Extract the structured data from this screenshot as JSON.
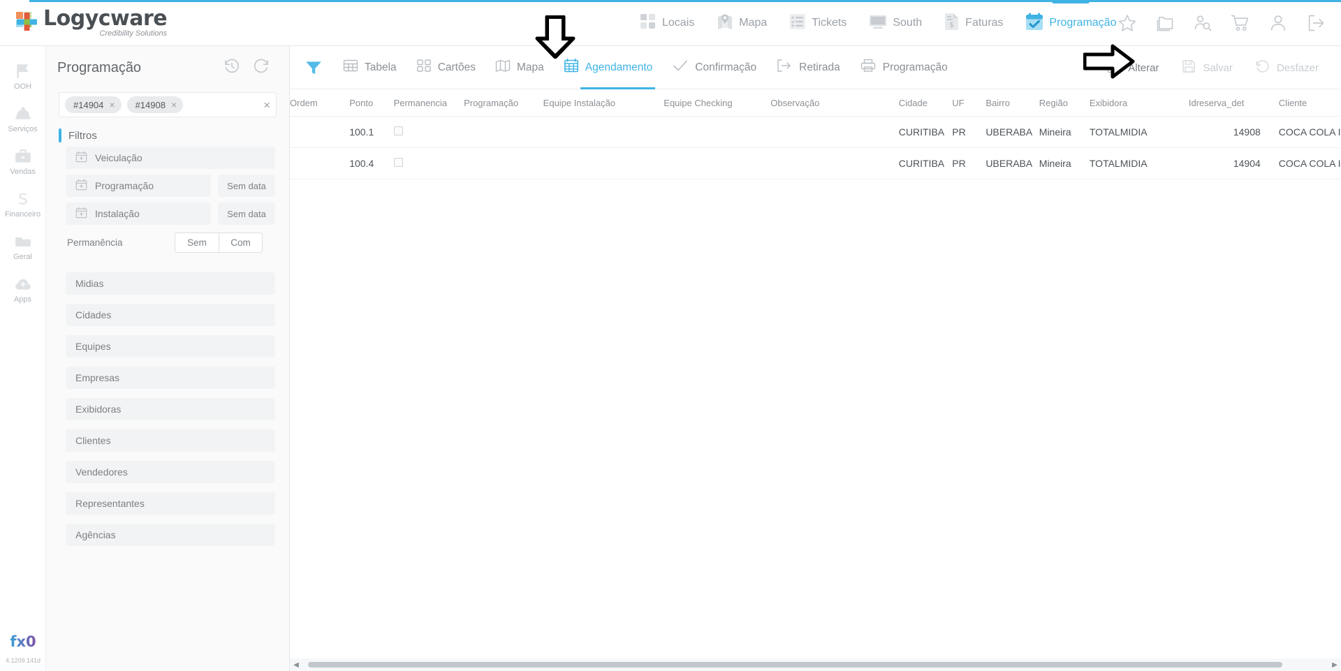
{
  "brand": {
    "name": "Logycware",
    "tagline": "Credibility Solutions",
    "version": "4.1209.141d",
    "accent_color": "#3fb3e4",
    "footer_logo": "fx0-logo"
  },
  "topnav": {
    "items": [
      {
        "label": "Locais",
        "icon": "grid-squares-icon",
        "active": false
      },
      {
        "label": "Mapa",
        "icon": "map-pin-icon",
        "active": false
      },
      {
        "label": "Tickets",
        "icon": "checklist-icon",
        "active": false
      },
      {
        "label": "South",
        "icon": "monitor-icon",
        "active": false
      },
      {
        "label": "Faturas",
        "icon": "invoice-dollar-icon",
        "active": false
      },
      {
        "label": "Programação",
        "icon": "calendar-check-icon",
        "active": true
      }
    ],
    "icons": [
      {
        "name": "favorites-star-icon"
      },
      {
        "name": "folders-icon"
      },
      {
        "name": "user-search-icon"
      },
      {
        "name": "shopping-cart-icon"
      },
      {
        "name": "user-account-icon"
      },
      {
        "name": "logout-icon"
      }
    ]
  },
  "rail": {
    "items": [
      {
        "label": "OOH",
        "icon": "flag-icon"
      },
      {
        "label": "Serviços",
        "icon": "hardhat-icon"
      },
      {
        "label": "Vendas",
        "icon": "briefcase-icon"
      },
      {
        "label": "Financeiro",
        "icon": "dollar-sign-icon"
      },
      {
        "label": "Geral",
        "icon": "folder-icon"
      },
      {
        "label": "Apps",
        "icon": "cloud-plus-icon"
      }
    ]
  },
  "panel": {
    "title": "Programação",
    "history_icon": "history-clock-icon",
    "refresh_icon": "refresh-icon",
    "chips": [
      {
        "label": "#14904"
      },
      {
        "label": "#14908"
      }
    ],
    "chips_clear": "×",
    "section_label": "Filtros",
    "filters": [
      {
        "label": "Veiculação",
        "icon": "calendar-plus-icon",
        "value": ""
      },
      {
        "label": "Programação",
        "icon": "calendar-plus-icon",
        "value": "Sem data"
      },
      {
        "label": "Instalação",
        "icon": "calendar-plus-icon",
        "value": "Sem data"
      }
    ],
    "permanencia": {
      "label": "Permanência",
      "options": [
        "Sem",
        "Com"
      ]
    },
    "accordion": [
      {
        "label": "Midias"
      },
      {
        "label": "Cidades"
      },
      {
        "label": "Equipes"
      },
      {
        "label": "Empresas"
      },
      {
        "label": "Exibidoras"
      },
      {
        "label": "Clientes"
      },
      {
        "label": "Vendedores"
      },
      {
        "label": "Representantes"
      },
      {
        "label": "Agências"
      }
    ]
  },
  "toolbar": {
    "filter_icon": "funnel-icon",
    "tabs": [
      {
        "label": "Tabela",
        "icon": "table-icon",
        "active": false
      },
      {
        "label": "Cartões",
        "icon": "cards-icon",
        "active": false
      },
      {
        "label": "Mapa",
        "icon": "map-fold-icon",
        "active": false
      },
      {
        "label": "Agendamento",
        "icon": "calendar-grid-icon",
        "active": true
      },
      {
        "label": "Confirmação",
        "icon": "check-icon",
        "active": false
      },
      {
        "label": "Retirada",
        "icon": "exit-arrow-icon",
        "active": false
      },
      {
        "label": "Programação",
        "icon": "printer-icon",
        "active": false
      }
    ],
    "actions": [
      {
        "label": "Alterar",
        "icon": "edit-pencil-icon",
        "disabled": false
      },
      {
        "label": "Salvar",
        "icon": "save-disk-icon",
        "disabled": true
      },
      {
        "label": "Desfazer",
        "icon": "undo-icon",
        "disabled": true
      }
    ]
  },
  "table": {
    "columns": [
      "Ordem",
      "Ponto",
      "Permanencia",
      "Programação",
      "Equipe Instalação",
      "Equipe Checking",
      "Observação",
      "Cidade",
      "UF",
      "Bairro",
      "Região",
      "Exibidora",
      "Idreserva_det",
      "Cliente"
    ],
    "rows": [
      {
        "ordem": "",
        "ponto": "100.1",
        "permanencia": false,
        "programacao": "",
        "equipe_instalacao": "",
        "equipe_checking": "",
        "observacao": "",
        "cidade": "CURITIBA",
        "uf": "PR",
        "bairro": "UBERABA",
        "regiao": "Mineira",
        "exibidora": "TOTALMIDIA",
        "idreserva_det": "14908",
        "cliente": "COCA COLA INDÚSTRIAS LTDA"
      },
      {
        "ordem": "",
        "ponto": "100.4",
        "permanencia": false,
        "programacao": "",
        "equipe_instalacao": "",
        "equipe_checking": "",
        "observacao": "",
        "cidade": "CURITIBA",
        "uf": "PR",
        "bairro": "UBERABA",
        "regiao": "Mineira",
        "exibidora": "TOTALMIDIA",
        "idreserva_det": "14904",
        "cliente": "COCA COLA INDÚSTRIAS LTDA"
      }
    ]
  },
  "scrollbar": {
    "left_arrow": "◀",
    "right_arrow": "▶"
  },
  "annotations": [
    {
      "name": "down-arrow-annotation",
      "direction": "down"
    },
    {
      "name": "right-arrow-annotation",
      "direction": "right"
    }
  ]
}
